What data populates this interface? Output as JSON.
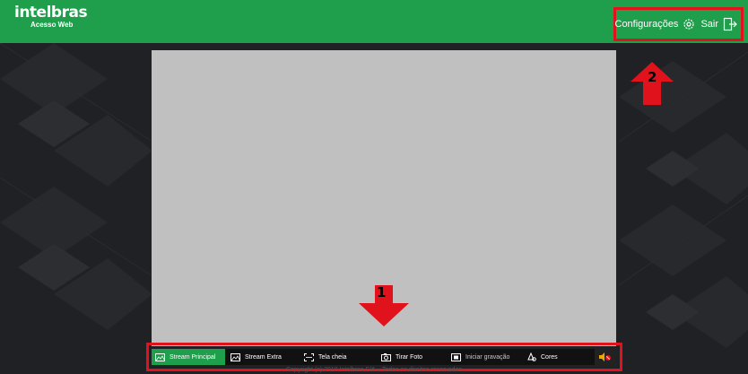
{
  "header": {
    "brand": "intelbras",
    "subtitle": "Acesso Web",
    "settings_label": "Configurações",
    "logout_label": "Sair"
  },
  "toolbar": {
    "buttons": [
      {
        "label": "Stream Principal",
        "icon": "image-icon",
        "active": true
      },
      {
        "label": "Stream Extra",
        "icon": "image-icon",
        "active": false
      },
      {
        "label": "Tela cheia",
        "icon": "fullscreen-icon",
        "active": false
      },
      {
        "label": "Tirar Foto",
        "icon": "camera-icon",
        "active": false
      },
      {
        "label": "Iniciar gravação",
        "icon": "record-icon",
        "active": false
      },
      {
        "label": "Cores",
        "icon": "palette-icon",
        "active": false
      }
    ],
    "audio_icon": "speaker-muted-icon"
  },
  "footer": {
    "copyright": "Copyright (c) 2018 Intelbras S/A – Todos os direitos reservados"
  },
  "annotations": [
    {
      "number": "1",
      "direction": "down"
    },
    {
      "number": "2",
      "direction": "up"
    }
  ],
  "colors": {
    "brand_green": "#1f9e4b",
    "annotation_red": "#e0121b",
    "video_gray": "#c0c0c0"
  }
}
